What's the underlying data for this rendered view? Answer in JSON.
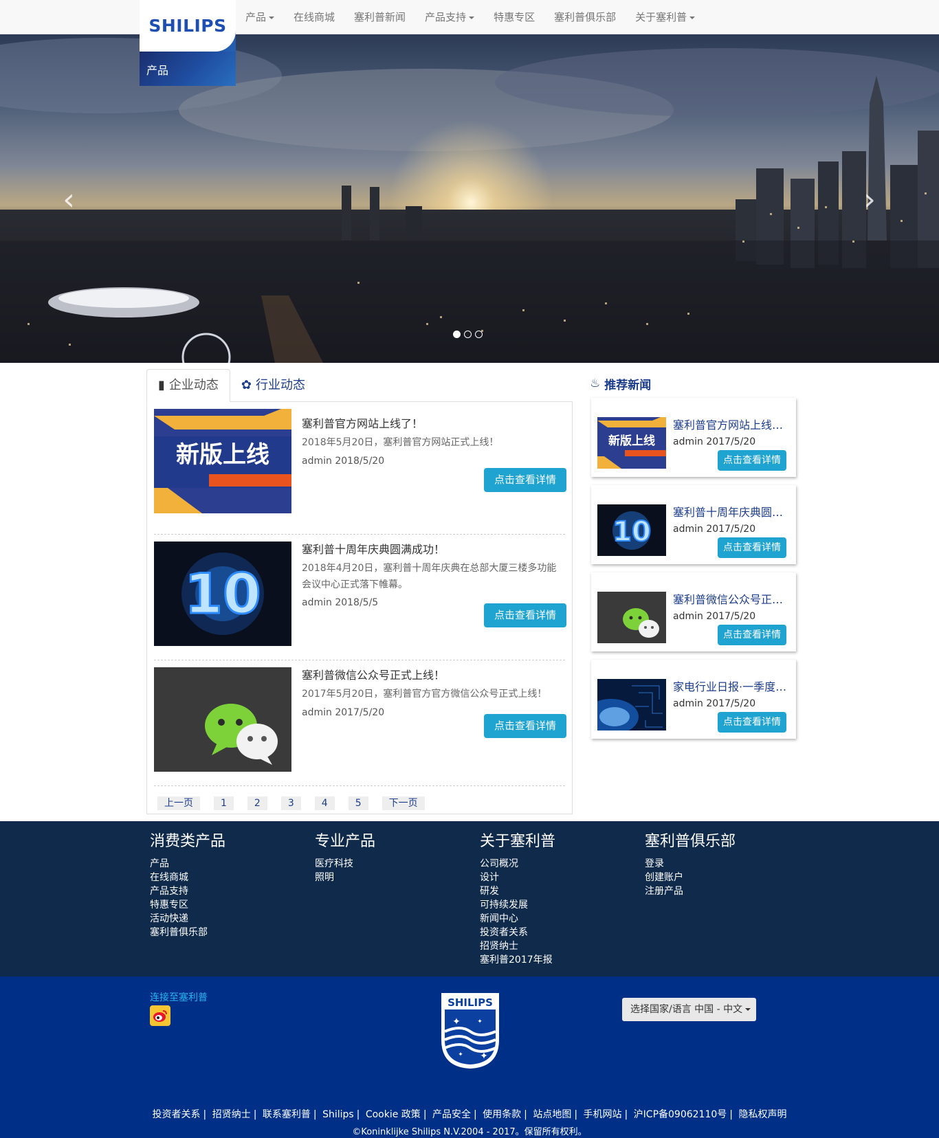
{
  "navbar": {
    "brand": "SHILIPS",
    "brand_sub": "产品",
    "items": [
      {
        "label": "产品",
        "dropdown": true
      },
      {
        "label": "在线商城",
        "dropdown": false
      },
      {
        "label": "塞利普新闻",
        "dropdown": false
      },
      {
        "label": "产品支持",
        "dropdown": true
      },
      {
        "label": "特惠专区",
        "dropdown": false
      },
      {
        "label": "塞利普俱乐部",
        "dropdown": false
      },
      {
        "label": "关于塞利普",
        "dropdown": true
      }
    ]
  },
  "hero": {
    "slide_count": 3,
    "active_slide": 1
  },
  "news": {
    "tabs": [
      {
        "label": "企业动态",
        "icon": "book-icon",
        "active": true
      },
      {
        "label": "行业动态",
        "icon": "leaf-icon",
        "active": false
      }
    ],
    "items": [
      {
        "title": "塞利普官方网站上线了！",
        "desc": "2018年5月20日，塞利普官方网站正式上线！",
        "meta": "admin 2018/5/20",
        "button": "点击查看详情",
        "image": "新版上线"
      },
      {
        "title": "塞利普十周年庆典圆满成功！",
        "desc": "2018年4月20日，塞利普十周年庆典在总部大厦三楼多功能会议中心正式落下帷幕。",
        "meta": "admin 2018/5/5",
        "button": "点击查看详情",
        "image": "10"
      },
      {
        "title": "塞利普微信公众号正式上线！",
        "desc": "2017年5月20日，塞利普官方官方微信公众号正式上线！",
        "meta": "admin 2017/5/20",
        "button": "点击查看详情",
        "image": "wechat"
      }
    ],
    "pager": [
      "上一页",
      "1",
      "2",
      "3",
      "4",
      "5",
      "下一页"
    ]
  },
  "recommended": {
    "title": "推荐新闻",
    "items": [
      {
        "title": "塞利普官方网站上线了！",
        "meta": "admin 2017/5/20",
        "button": "点击查看详情"
      },
      {
        "title": "塞利普十周年庆典圆满成功！",
        "meta": "admin 2017/5/20",
        "button": "点击查看详情"
      },
      {
        "title": "塞利普微信公众号正式上线！",
        "meta": "admin 2017/5/20",
        "button": "点击查看详情"
      },
      {
        "title": "家电行业日报·一季度回顾",
        "meta": "admin 2017/5/20",
        "button": "点击查看详情"
      }
    ]
  },
  "footer": {
    "columns": [
      {
        "title": "消费类产品",
        "links": [
          "产品",
          "在线商城",
          "产品支持",
          "特惠专区",
          "活动快递",
          "塞利普俱乐部"
        ]
      },
      {
        "title": "专业产品",
        "links": [
          "医疗科技",
          "照明"
        ]
      },
      {
        "title": "关于塞利普",
        "links": [
          "公司概况",
          "设计",
          "研发",
          "可持续发展",
          "新闻中心",
          "投资者关系",
          "招贤纳士",
          "塞利普2017年报"
        ]
      },
      {
        "title": "塞利普俱乐部",
        "links": [
          "登录",
          "创建账户",
          "注册产品"
        ]
      }
    ],
    "connect": "连接至塞利普",
    "shield_text": "SHILIPS",
    "lang_button": "选择国家/语言 中国 - 中文",
    "bottom_links": [
      "投资者关系",
      "招贤纳士",
      "联系塞利普",
      "Shilips",
      "Cookie 政策",
      "产品安全",
      "使用条款",
      "站点地图",
      "手机网站",
      "沪ICP备09062110号",
      "隐私权声明"
    ],
    "copyright": "©Koninklijke Shilips N.V.2004 - 2017。保留所有权利。"
  },
  "colors": {
    "accent": "#1fa3d1",
    "brand_blue": "#1c3d8b",
    "footer_dark": "#0f2a4b",
    "footer_blue": "#002f87"
  }
}
